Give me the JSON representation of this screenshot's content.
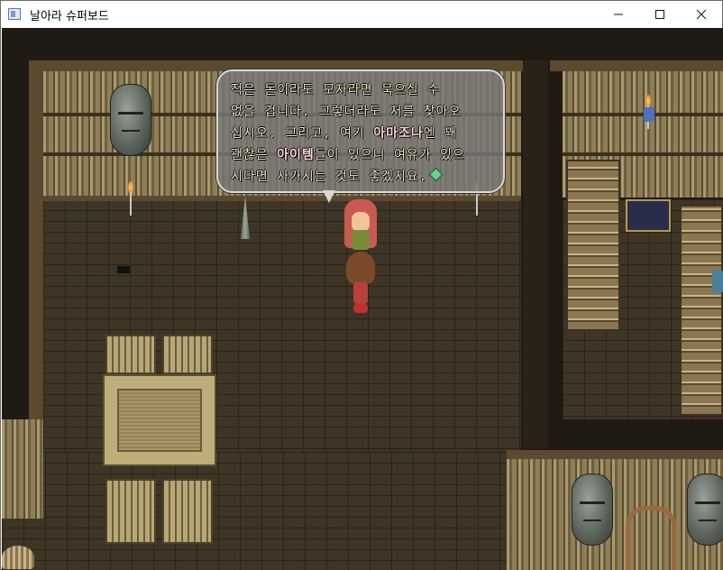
{
  "window": {
    "title": "날아라 슈퍼보드",
    "icon": "app-window-icon",
    "minimize_glyph": "—",
    "maximize_glyph": "☐",
    "close_glyph": "✕"
  },
  "dialogue": {
    "lines": [
      {
        "text": "  적은 돈이라도 모자라면 묵으실 수",
        "highlight": ""
      },
      {
        "text": "없을 겁니다. 그렇더라도 저를 찾아오",
        "highlight": ""
      },
      {
        "pre": "십시오. 그리고, 여기 ",
        "highlight": "아마조나",
        "post": "엔 꽤"
      },
      {
        "pre": "괜찮은 ",
        "highlight": "아이템",
        "post": "들이 있으니 여유가 있으"
      },
      {
        "text": "시다면 사가시는 것도 좋겠지요.",
        "highlight": ""
      }
    ],
    "continue_icon": "green-gem-icon"
  },
  "colors": {
    "text": "#f4e6c4",
    "highlight": "#ffd7d7",
    "floor": "#3f3526",
    "wall": "#8c7a55"
  }
}
